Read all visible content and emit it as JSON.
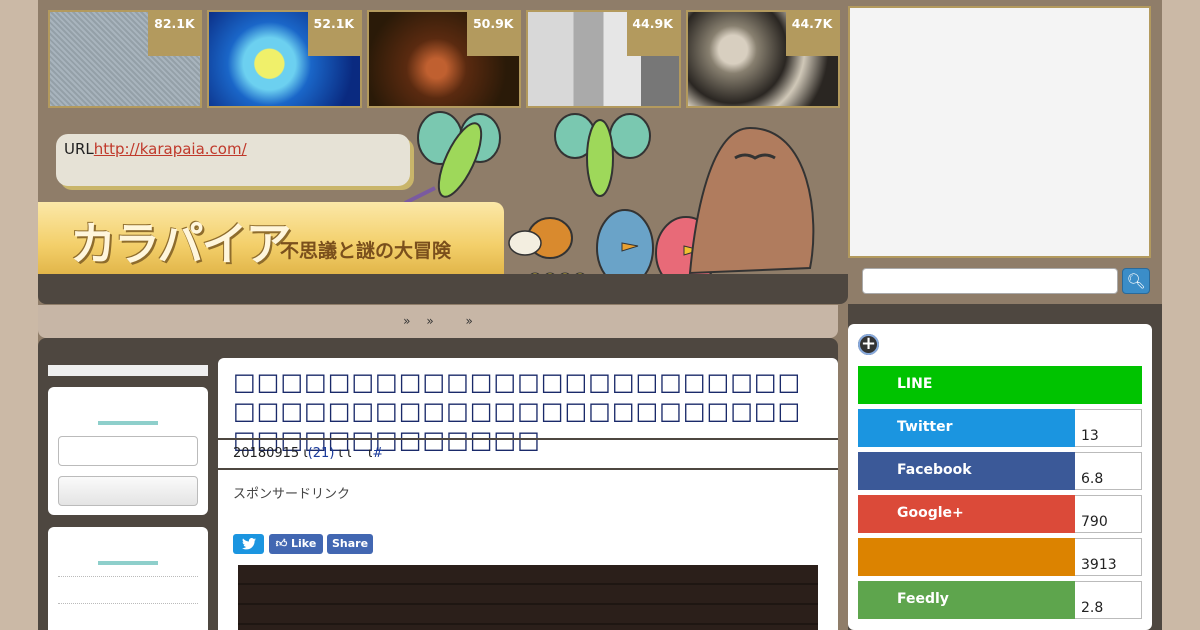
{
  "thumbnails": [
    {
      "count": "82.1K"
    },
    {
      "count": "52.1K"
    },
    {
      "count": "50.9K"
    },
    {
      "count": "44.9K"
    },
    {
      "count": "44.7K"
    }
  ],
  "header": {
    "url_prefix": "URL",
    "url": "http://karapaia.com/",
    "logo": "カラパイア",
    "tagline": "不思議と謎の大冒険"
  },
  "nav": {
    "items": [
      "»",
      "»",
      "»"
    ]
  },
  "article": {
    "title": "□□□□□□□□□□□□□□□□□□□□□□□□□□□□□□□□□□□□□□□□□□□□□□□□□□□□□□□□□□□□□",
    "meta_date": "20180915",
    "meta_sep1": "ι",
    "meta_comments": "(21)",
    "meta_sep2": "ι ι",
    "meta_sep3": "ι",
    "meta_hash": "#",
    "sponsor": "スポンサードリンク"
  },
  "social_small": {
    "like": "Like",
    "share": "Share"
  },
  "share": [
    {
      "label": "LINE",
      "count": null,
      "color": "#00c300"
    },
    {
      "label": "Twitter",
      "count": "13",
      "color": "#1b95e0"
    },
    {
      "label": "Facebook",
      "count": "6.8",
      "color": "#3b5998"
    },
    {
      "label": "Google+",
      "count": "790",
      "color": "#db4a39"
    },
    {
      "label": "",
      "count": "3913",
      "color": "#dc8300"
    },
    {
      "label": "Feedly",
      "count": "2.8",
      "color": "#5ea54d"
    }
  ],
  "search": {
    "icon": "search-icon"
  }
}
